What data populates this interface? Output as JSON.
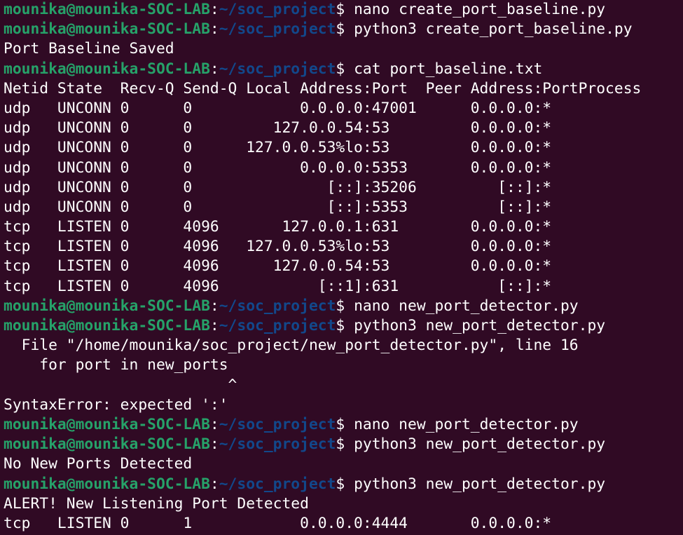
{
  "colors": {
    "background": "#300a24",
    "user_host": "#26a269",
    "path": "#12488b",
    "text": "#ffffff"
  },
  "prompt": {
    "user_host": "mounika@mounika-SOC-LAB",
    "colon": ":",
    "path": "~/soc_project",
    "sign": "$ "
  },
  "lines": [
    {
      "kind": "prompt",
      "text": "nano create_port_baseline.py"
    },
    {
      "kind": "prompt",
      "text": "python3 create_port_baseline.py"
    },
    {
      "kind": "output",
      "text": "Port Baseline Saved"
    },
    {
      "kind": "prompt",
      "text": "cat port_baseline.txt"
    },
    {
      "kind": "output",
      "text": "Netid State  Recv-Q Send-Q Local Address:Port  Peer Address:PortProcess"
    },
    {
      "kind": "output",
      "text": "udp   UNCONN 0      0            0.0.0.0:47001      0.0.0.0:*"
    },
    {
      "kind": "output",
      "text": "udp   UNCONN 0      0         127.0.0.54:53         0.0.0.0:*"
    },
    {
      "kind": "output",
      "text": "udp   UNCONN 0      0      127.0.0.53%lo:53         0.0.0.0:*"
    },
    {
      "kind": "output",
      "text": "udp   UNCONN 0      0            0.0.0.0:5353       0.0.0.0:*"
    },
    {
      "kind": "output",
      "text": "udp   UNCONN 0      0               [::]:35206         [::]:*"
    },
    {
      "kind": "output",
      "text": "udp   UNCONN 0      0               [::]:5353          [::]:*"
    },
    {
      "kind": "output",
      "text": "tcp   LISTEN 0      4096       127.0.0.1:631        0.0.0.0:*"
    },
    {
      "kind": "output",
      "text": "tcp   LISTEN 0      4096   127.0.0.53%lo:53         0.0.0.0:*"
    },
    {
      "kind": "output",
      "text": "tcp   LISTEN 0      4096      127.0.0.54:53         0.0.0.0:*"
    },
    {
      "kind": "output",
      "text": "tcp   LISTEN 0      4096           [::1]:631           [::]:*"
    },
    {
      "kind": "prompt",
      "text": "nano new_port_detector.py"
    },
    {
      "kind": "prompt",
      "text": "python3 new_port_detector.py"
    },
    {
      "kind": "output",
      "text": "  File \"/home/mounika/soc_project/new_port_detector.py\", line 16"
    },
    {
      "kind": "output",
      "text": "    for port in new_ports"
    },
    {
      "kind": "output",
      "text": "                         ^"
    },
    {
      "kind": "output",
      "text": "SyntaxError: expected ':'"
    },
    {
      "kind": "prompt",
      "text": "nano new_port_detector.py"
    },
    {
      "kind": "prompt",
      "text": "python3 new_port_detector.py"
    },
    {
      "kind": "output",
      "text": "No New Ports Detected"
    },
    {
      "kind": "prompt",
      "text": "python3 new_port_detector.py"
    },
    {
      "kind": "output",
      "text": "ALERT! New Listening Port Detected"
    },
    {
      "kind": "output",
      "text": "tcp   LISTEN 0      1            0.0.0.0:4444       0.0.0.0:*"
    }
  ]
}
